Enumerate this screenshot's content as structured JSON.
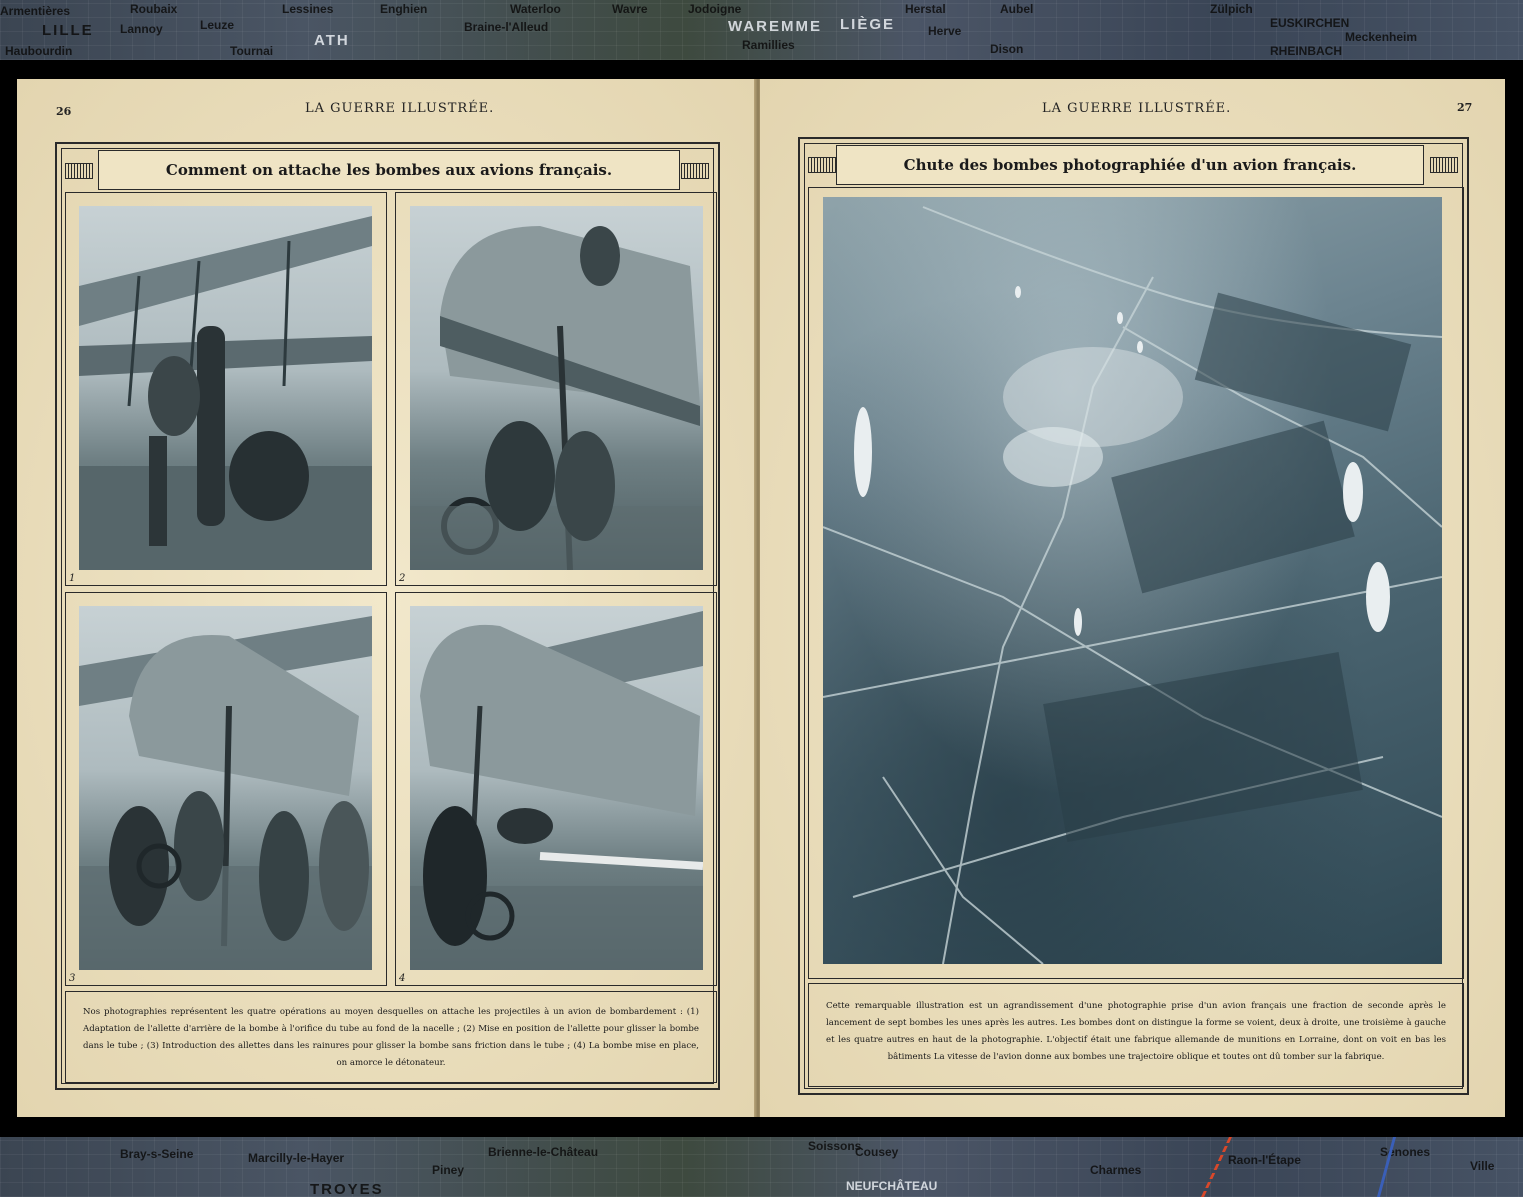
{
  "map_top": {
    "places": [
      "Roubaix",
      "LILLE",
      "Lannoy",
      "Armentières",
      "Haubourdin",
      "Leuze",
      "Lessines",
      "Enghien",
      "Tournai",
      "ATH",
      "Braine-l'Alleud",
      "Waterloo",
      "Wavre",
      "Jodoigne",
      "WAREMME",
      "Ramillies",
      "LIÈGE",
      "Herstal",
      "Aubel",
      "Herve",
      "Dison",
      "Zülpich",
      "EUSKIRCHEN",
      "Meckenheim",
      "RHEINBACH"
    ]
  },
  "map_bottom": {
    "places": [
      "Bray-s-Seine",
      "Marcilly-le-Hayer",
      "TROYES",
      "Piney",
      "Brienne-le-Château",
      "Soissons",
      "Cousey",
      "NEUFCHÂTEAU",
      "Charmes",
      "Raon-l'Étape",
      "Senones",
      "Ville"
    ]
  },
  "left_page": {
    "page_number": "26",
    "running_head": "LA GUERRE ILLUSTRÉE.",
    "title": "Comment on attache les bombes aux avions français.",
    "photos": [
      {
        "number": "1"
      },
      {
        "number": "2"
      },
      {
        "number": "3"
      },
      {
        "number": "4"
      }
    ],
    "caption": "Nos photographies représentent les quatre opérations au moyen desquelles on attache les projectiles à un avion de bombardement : (1) Adaptation de l'allette d'arrière de la bombe à l'orifice du tube au fond de la nacelle ; (2) Mise en position de l'allette pour glisser la bombe dans le tube ; (3) Introduction des allettes dans les rainures pour glisser la bombe sans friction dans le tube ; (4) La bombe mise en place, on amorce le détonateur."
  },
  "right_page": {
    "page_number": "27",
    "running_head": "LA GUERRE ILLUSTRÉE.",
    "title": "Chute des bombes photographiée d'un avion français.",
    "caption": "Cette remarquable illustration est un agrandissement d'une photographie prise d'un avion français une fraction de seconde après le lancement de sept bombes les unes après les autres. Les bombes dont on distingue la forme se voient, deux à droite, une troisième à gauche et les quatre autres en haut de la photographie. L'objectif était une fabrique allemande de munitions en Lorraine, dont on voit en bas les bâtiments La vitesse de l'avion donne aux bombes une trajectoire oblique et toutes ont dû tomber sur la fabrique."
  }
}
